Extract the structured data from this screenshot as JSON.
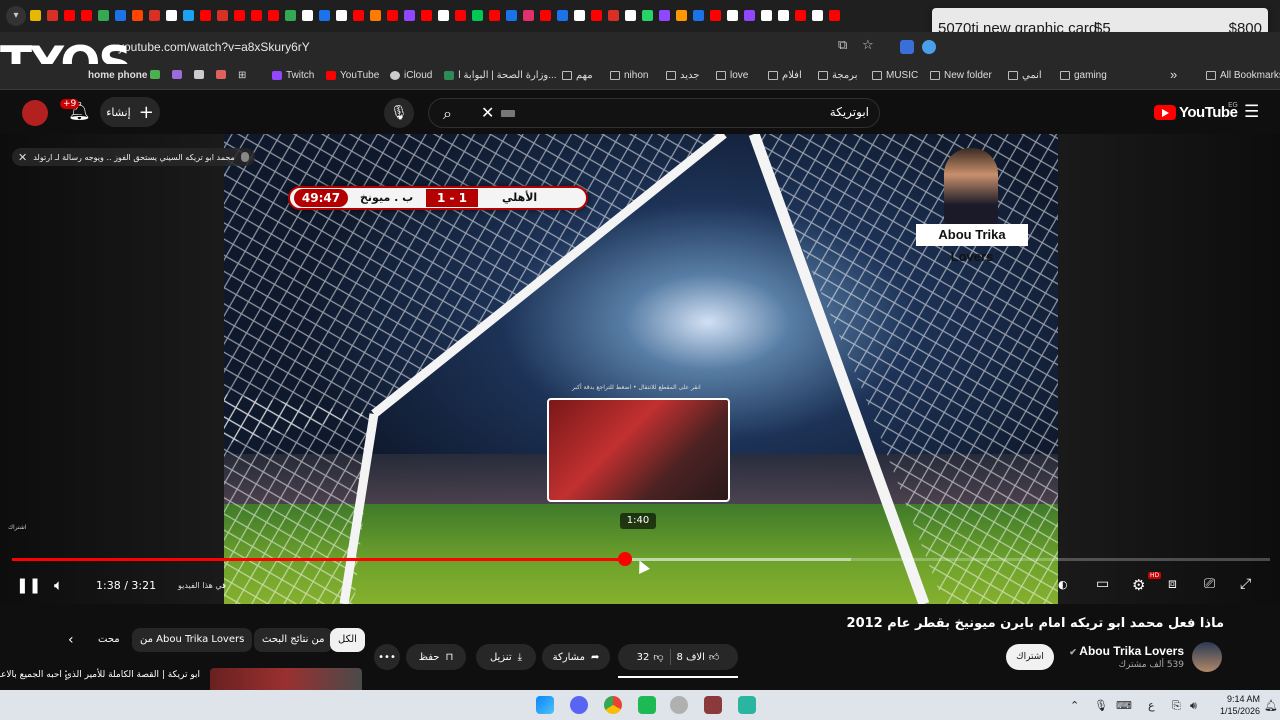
{
  "browser": {
    "url": "youtube.com/watch?v=a8xSkury6rY",
    "bookmarks": [
      {
        "label": "Twitch"
      },
      {
        "label": "YouTube"
      },
      {
        "label": "iCloud"
      },
      {
        "label": "وزارة الصحة | البوابة ا..."
      },
      {
        "label": "مهم"
      },
      {
        "label": "nihon"
      },
      {
        "label": "جديد"
      },
      {
        "label": "love"
      },
      {
        "label": "افلام"
      },
      {
        "label": "برمجة"
      },
      {
        "label": "MUSIC"
      },
      {
        "label": "New folder"
      },
      {
        "label": "انمي"
      },
      {
        "label": "gaming"
      }
    ],
    "bookmarks_overflow": "»",
    "all_bookmarks": "All Bookmarks",
    "partial_bookmark": "home phone"
  },
  "notification": {
    "title": "5070ti new graphic card",
    "price_low": "$5",
    "price_high": "$800"
  },
  "watermark": {
    "text": "TYOS"
  },
  "youtube_header": {
    "notification_count": "+9",
    "create_label": "إنشاء",
    "search_value": "ابوتريكة",
    "logo_text": "YouTube",
    "region": "EG"
  },
  "player": {
    "title_overlay": "محمد ابو تريكه السيني يستحق الفوز .. ويوجه رسالة لـ ارتولد",
    "scoreboard": {
      "time": "49:47",
      "away": "ب . ميونخ",
      "score": "1 - 1",
      "home": "الأهلي"
    },
    "channel_watermark": "Abou Trika Lovers",
    "preview_caption": "انقر على المقطع للانتقال • اضغط للتراجع بدقة أكبر",
    "preview_time": "1:40",
    "subscribe_mini": "اشتراك",
    "current_time": "1:38",
    "duration": "3:21",
    "time_display": "1:38 / 3:21",
    "chapter_label": "في هذا الفيديو",
    "progress_fraction": 0.487,
    "buffer_fraction": 0.667
  },
  "video_info": {
    "title": "ماذا فعل محمد ابو تريكه امام بايرن ميونيخ بقطر عام 2012",
    "channel_name": "Abou Trika Lovers",
    "subscriber_count": "539 ألف مشترك",
    "subscribe_label": "اشتراك",
    "likes": "8 الاف",
    "dislikes": "32",
    "share_label": "مشاركة",
    "download_label": "تنزيل",
    "save_label": "حفظ",
    "more_label": "•••"
  },
  "related": {
    "chips": [
      {
        "label": "الكل"
      },
      {
        "label": "من نتائج البحث"
      },
      {
        "label": "من Abou Trika Lovers"
      },
      {
        "label": "محت"
      }
    ],
    "first_title": "ابو تريكة | القصة الكاملة للأمير الذي احبه الجميع بالاعلام..."
  },
  "taskbar": {
    "time": "9:14 AM",
    "date": "1/15/2026",
    "lang": "ع"
  },
  "colors": {
    "accent": "#ff0000",
    "background": "#0f0f0f",
    "chip": "#272727"
  }
}
